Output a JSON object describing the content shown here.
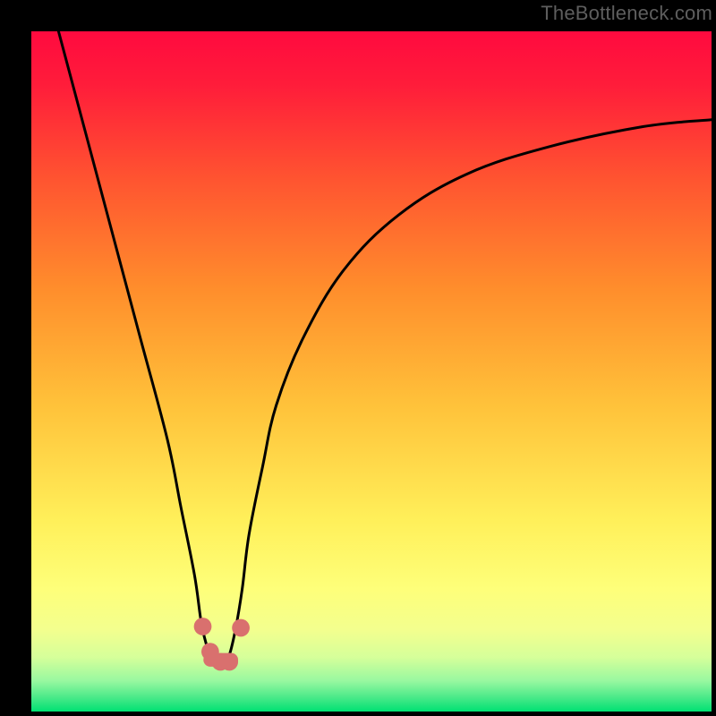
{
  "watermark": "TheBottleneck.com",
  "chart_data": {
    "type": "line",
    "title": "",
    "xlabel": "",
    "ylabel": "",
    "xlim": [
      0,
      100
    ],
    "ylim": [
      0,
      100
    ],
    "background_gradient": {
      "top": "#ff0a3f",
      "mid": "#fefd73",
      "bottom": "#00e676"
    },
    "series": [
      {
        "name": "curve",
        "x": [
          4,
          8,
          12,
          16,
          20,
          22,
          24,
          25,
          26,
          27,
          28,
          29,
          30,
          31,
          32,
          34,
          36,
          40,
          46,
          54,
          64,
          76,
          90,
          100
        ],
        "values": [
          100,
          85,
          70,
          55,
          40,
          30,
          20,
          13,
          9,
          7,
          7,
          8,
          12,
          18,
          26,
          36,
          45,
          55,
          65,
          73,
          79,
          83,
          86,
          87
        ]
      }
    ],
    "markers": [
      {
        "name": "marker-left-upper",
        "x": 25.2,
        "y": 12.5,
        "r": 1.3,
        "color": "#d9706e"
      },
      {
        "name": "marker-left-lower",
        "x": 26.3,
        "y": 8.8,
        "r": 1.3,
        "color": "#d9706e"
      },
      {
        "name": "marker-right-upper",
        "x": 30.8,
        "y": 12.3,
        "r": 1.3,
        "color": "#d9706e"
      },
      {
        "name": "marker-bottom-a",
        "x": 27.8,
        "y": 7.3,
        "r": 1.3,
        "color": "#d9706e"
      },
      {
        "name": "marker-bottom-b",
        "x": 29.1,
        "y": 7.3,
        "r": 1.3,
        "color": "#d9706e"
      }
    ],
    "bottom_bar": {
      "start_x": 26.3,
      "end_x": 29.4,
      "y": 7.6,
      "thickness": 2.0,
      "color": "#d9706e"
    }
  }
}
